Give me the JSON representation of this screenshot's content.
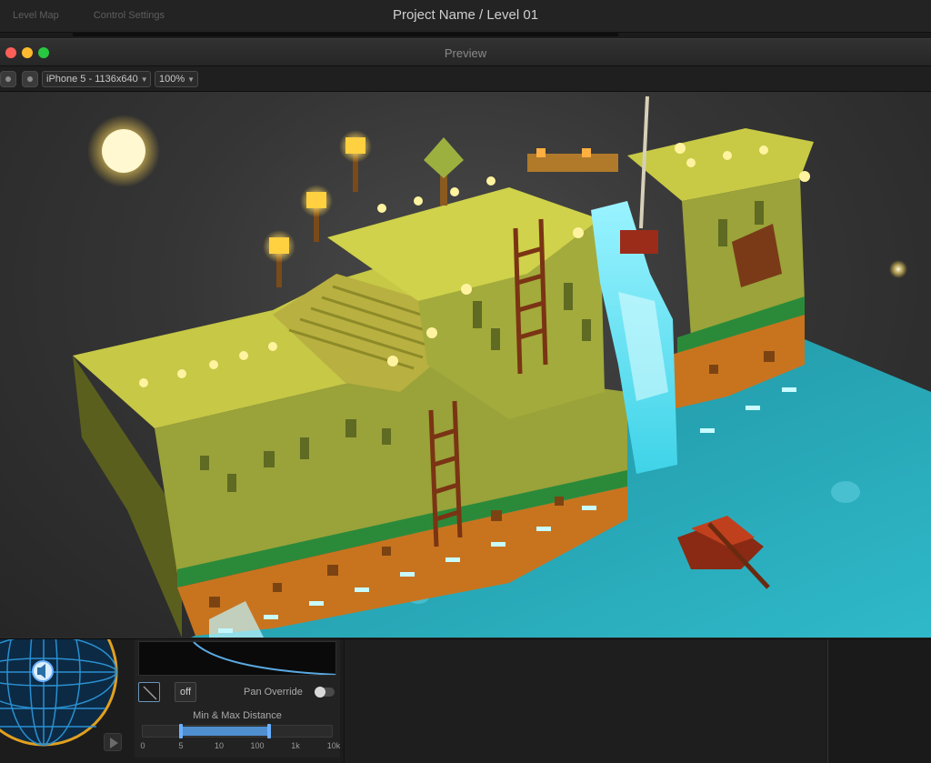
{
  "app": {
    "tabs": [
      "Level Map",
      "Control Settings"
    ],
    "title": "Project Name / Level 01"
  },
  "preview": {
    "title": "Preview",
    "device_select": "iPhone 5 - 1136x640",
    "zoom_select": "100%"
  },
  "audio_panel": {
    "off_label": "off",
    "pan_override_label": "Pan Override",
    "pan_override_on": false,
    "range_label": "Min & Max Distance",
    "scale_labels": [
      "0",
      "5",
      "10",
      "100",
      "1k",
      "10k"
    ],
    "min_position": 1,
    "max_position": 3.3
  },
  "icons": {
    "close": "close-icon",
    "minimize": "minimize-icon",
    "zoom": "zoom-icon",
    "speaker": "speaker-icon",
    "play": "play-icon",
    "curve": "curve-icon"
  },
  "colors": {
    "water": "#2fb9c9",
    "grass": "#b6b83a",
    "dirt": "#c8741f",
    "slider_accent": "#4f8fd0",
    "sphere_ring": "#e0a020"
  }
}
